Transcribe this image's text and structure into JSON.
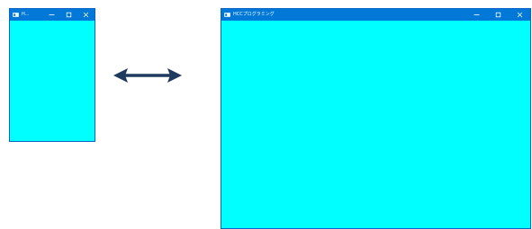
{
  "colors": {
    "titlebar": "#0078d7",
    "client": "#00ffff",
    "arrow": "#1f3a5f"
  },
  "small_window": {
    "title": "H...",
    "icons": [
      "app-icon",
      "minimize-icon",
      "maximize-icon",
      "close-icon"
    ]
  },
  "large_window": {
    "title": "HCCプログラミング",
    "icons": [
      "app-icon",
      "minimize-icon",
      "maximize-icon",
      "close-icon"
    ]
  },
  "resize_indicator": {
    "icon": "double-headed-arrow-icon"
  }
}
